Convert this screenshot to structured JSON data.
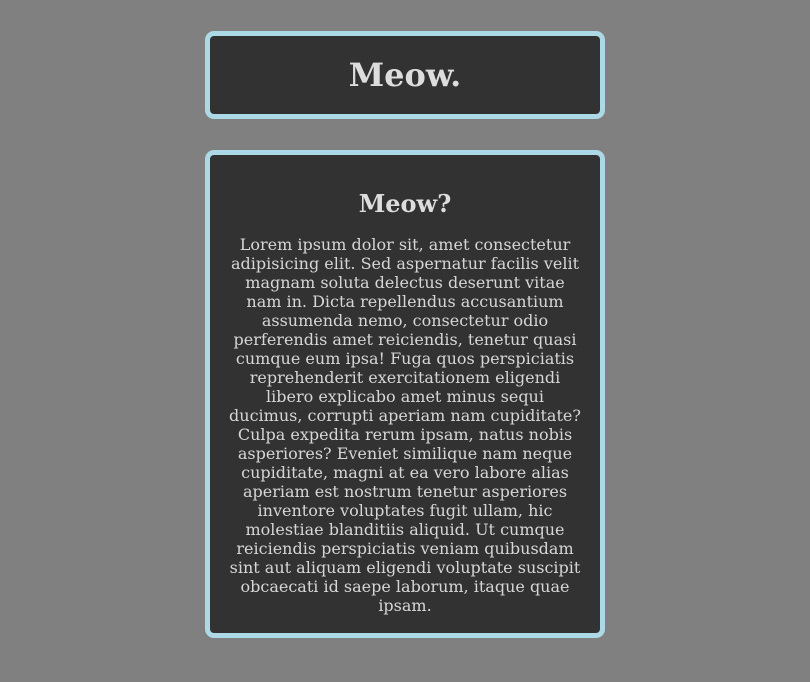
{
  "header": {
    "title": "Meow."
  },
  "content": {
    "title": "Meow?",
    "body": "Lorem ipsum dolor sit, amet consectetur adipisicing elit. Sed aspernatur facilis velit magnam soluta delectus deserunt vitae nam in. Dicta repellendus accusantium assumenda nemo, consectetur odio perferendis amet reiciendis, tenetur quasi cumque eum ipsa! Fuga quos perspiciatis reprehenderit exercitationem eligendi libero explicabo amet minus sequi ducimus, corrupti aperiam nam cupiditate? Culpa expedita rerum ipsam, natus nobis asperiores? Eveniet similique nam neque cupiditate, magni at ea vero labore alias aperiam est nostrum tenetur asperiores inventore voluptates fugit ullam, hic molestiae blanditiis aliquid. Ut cumque reiciendis perspiciatis veniam quibusdam sint aut aliquam eligendi voluptate suscipit obcaecati id saepe laborum, itaque quae ipsam."
  },
  "colors": {
    "page_background": "#808080",
    "card_background": "#323232",
    "card_border": "#add8e6",
    "text": "#dddddd"
  }
}
